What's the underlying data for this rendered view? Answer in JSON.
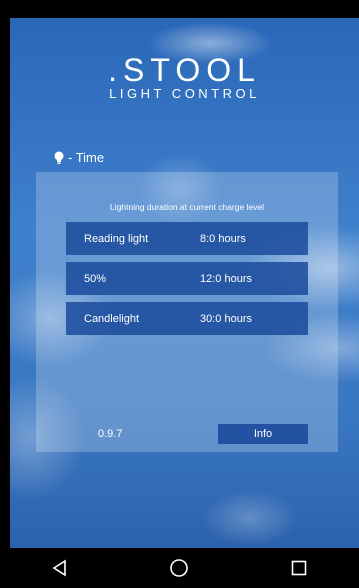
{
  "app": {
    "logo_title": ".STOOL",
    "logo_subtitle": "LIGHT CONTROL"
  },
  "section": {
    "title": "- Time",
    "icon": "lightbulb-icon"
  },
  "panel": {
    "caption": "Lightning duration at current charge level",
    "rows": [
      {
        "label": "Reading light",
        "value": "8:0 hours"
      },
      {
        "label": "50%",
        "value": "12:0 hours"
      },
      {
        "label": "Candlelight",
        "value": "30:0 hours"
      }
    ],
    "version": "0.9.7",
    "info_label": "Info"
  },
  "nav": {
    "back_icon": "back-triangle-icon",
    "home_icon": "home-circle-icon",
    "recents_icon": "recents-square-icon"
  },
  "colors": {
    "sky": "#3f80cc",
    "row_bg": "#1b4b9c",
    "text": "#ffffff"
  }
}
